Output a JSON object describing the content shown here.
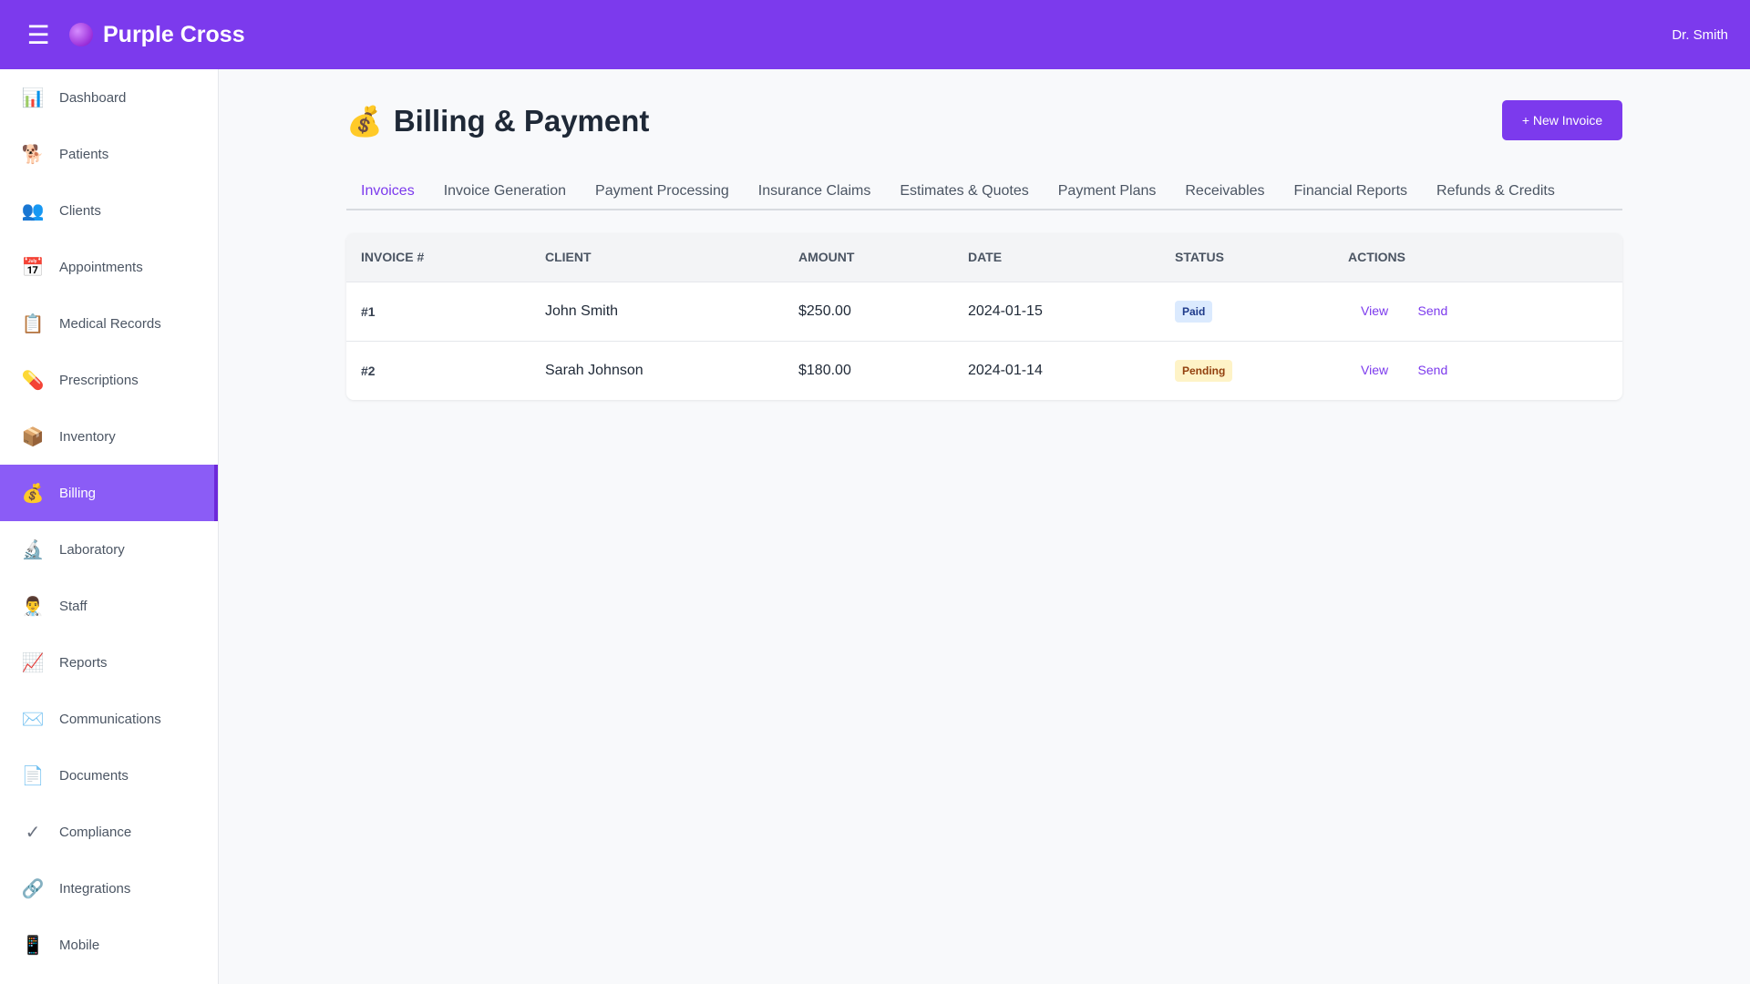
{
  "topbar": {
    "menu_icon": "☰",
    "brand": "Purple Cross",
    "user": "Dr. Smith"
  },
  "sidebar": {
    "items": [
      {
        "label": "Dashboard",
        "icon": "📊",
        "icon_name": "bar-chart-icon"
      },
      {
        "label": "Patients",
        "icon": "🐕",
        "icon_name": "dog-icon"
      },
      {
        "label": "Clients",
        "icon": "👥",
        "icon_name": "people-icon"
      },
      {
        "label": "Appointments",
        "icon": "📅",
        "icon_name": "calendar-icon"
      },
      {
        "label": "Medical Records",
        "icon": "📋",
        "icon_name": "clipboard-icon"
      },
      {
        "label": "Prescriptions",
        "icon": "💊",
        "icon_name": "pill-icon"
      },
      {
        "label": "Inventory",
        "icon": "📦",
        "icon_name": "package-icon"
      },
      {
        "label": "Billing",
        "icon": "💰",
        "icon_name": "money-bag-icon",
        "active": true
      },
      {
        "label": "Laboratory",
        "icon": "🔬",
        "icon_name": "microscope-icon"
      },
      {
        "label": "Staff",
        "icon": "👨‍⚕️",
        "icon_name": "doctor-icon"
      },
      {
        "label": "Reports",
        "icon": "📈",
        "icon_name": "trend-chart-icon"
      },
      {
        "label": "Communications",
        "icon": "✉️",
        "icon_name": "envelope-icon"
      },
      {
        "label": "Documents",
        "icon": "📄",
        "icon_name": "document-icon"
      },
      {
        "label": "Compliance",
        "icon": "✓",
        "icon_name": "checkmark-icon"
      },
      {
        "label": "Integrations",
        "icon": "🔗",
        "icon_name": "link-icon"
      },
      {
        "label": "Mobile",
        "icon": "📱",
        "icon_name": "mobile-phone-icon"
      }
    ]
  },
  "page": {
    "title_icon": "💰",
    "title": "Billing & Payment",
    "new_button": "+ New Invoice"
  },
  "tabs": [
    {
      "label": "Invoices",
      "active": true
    },
    {
      "label": "Invoice Generation"
    },
    {
      "label": "Payment Processing"
    },
    {
      "label": "Insurance Claims"
    },
    {
      "label": "Estimates & Quotes"
    },
    {
      "label": "Payment Plans"
    },
    {
      "label": "Receivables"
    },
    {
      "label": "Financial Reports"
    },
    {
      "label": "Refunds & Credits"
    }
  ],
  "table": {
    "headers": [
      "INVOICE #",
      "CLIENT",
      "AMOUNT",
      "DATE",
      "STATUS",
      "ACTIONS"
    ],
    "rows": [
      {
        "invoice": "#1",
        "client": "John Smith",
        "amount": "$250.00",
        "date": "2024-01-15",
        "status": "Paid",
        "status_type": "paid",
        "view": "View",
        "send": "Send"
      },
      {
        "invoice": "#2",
        "client": "Sarah Johnson",
        "amount": "$180.00",
        "date": "2024-01-14",
        "status": "Pending",
        "status_type": "pending",
        "view": "View",
        "send": "Send"
      }
    ]
  },
  "colors": {
    "brand": "#7c3aed",
    "active_nav": "#8b5cf6",
    "paid_badge": "#dbeafe",
    "pending_badge": "#fef3c7"
  }
}
